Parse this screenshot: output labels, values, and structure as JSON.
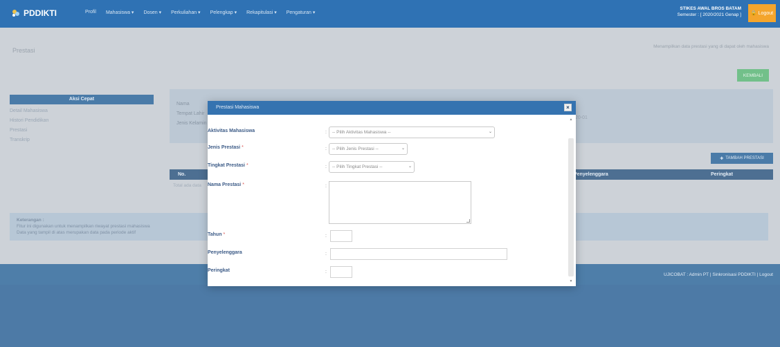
{
  "app": {
    "brand": "PDDIKTI",
    "nav": [
      "Profil",
      "Mahasiswa ▾",
      "Dosen ▾",
      "Perkuliahan ▾",
      "Pelengkap ▾",
      "Rekapitulasi ▾",
      "Pengaturan ▾"
    ],
    "user_name": "STIKES AWAL BROS BATAM",
    "semester": "Semester : [ 2020/2021 Genap ]",
    "logout": "Logout"
  },
  "page": {
    "title": "Prestasi",
    "hint": "Menampilkan data prestasi yang di dapat oleh mahasiswa",
    "back_button": "KEMBALI",
    "aksi_header": "Aksi Cepat",
    "aksi_items": [
      "Detail Mahasiswa",
      "Histori Pendidikan",
      "Prestasi",
      "Transkrip"
    ],
    "info_labels": [
      "Nama",
      "Tempat Lahir",
      "Jenis Kelamin"
    ],
    "info_right": "20-01",
    "add_button": "TAMBAH PRESTASI",
    "table_headers": {
      "no": "No.",
      "penyelenggara": "Penyelenggara",
      "peringkat": "Peringkat"
    },
    "empty_text": "Total ada data",
    "keterangan_title": "Keterangan :",
    "keterangan_lines": [
      "Fitur ini digunakan untuk menampilkan riwayat prestasi mahasiswa",
      "Data yang tampil di atas merupakan data pada periode aktif"
    ],
    "footer": "UJICOBAT : Admin PT | Sinkronisasi PDDIKTI | Logout"
  },
  "modal": {
    "title": "Prestasi Mahasiswa",
    "fields": {
      "aktivitas_label": "Aktivitas Mahasiswa",
      "aktivitas_placeholder": "-- Pilih Aktivitas Mahasiswa --",
      "jenis_label": "Jenis Prestasi",
      "jenis_placeholder": "-- Pilih Jenis Prestasi --",
      "tingkat_label": "Tingkat Prestasi",
      "tingkat_placeholder": "-- Pilih Tingkat Prestasi --",
      "nama_label": "Nama Prestasi",
      "tahun_label": "Tahun",
      "penyelenggara_label": "Penyelenggara",
      "peringkat_label": "Peringkat"
    },
    "colon": ":",
    "required_mark": "*"
  },
  "colors": {
    "nav": "#2f72b4",
    "modal_header": "#3573b0",
    "label_blue": "#3b5a86",
    "logout_orange": "#f4a52c",
    "required_red": "#d9534f"
  }
}
